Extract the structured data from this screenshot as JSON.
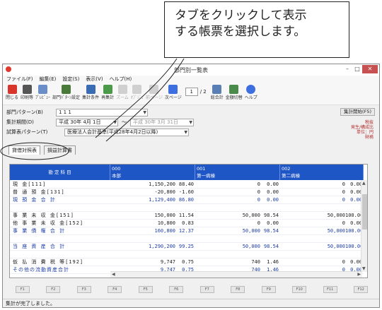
{
  "callout": {
    "line1": "タブをクリックして表示",
    "line2": "する帳票を選択します。"
  },
  "window": {
    "title": "部門別一覧表",
    "minimize": "–",
    "maximize": "□",
    "close": "✕"
  },
  "menu": [
    "ファイル(F)",
    "編集(E)",
    "設定(S)",
    "表示(V)",
    "ヘルプ(H)"
  ],
  "toolbar": {
    "buttons": [
      {
        "label": "閉じる",
        "icon": "close-icon",
        "color": "#d9362b"
      },
      {
        "label": "印刷等",
        "icon": "printer-icon",
        "color": "#555555"
      },
      {
        "label": "ﾌﾟﾚﾋﾞｭｰ",
        "icon": "preview-icon",
        "color": "#6a8fc8"
      },
      {
        "label": "部門ﾊﾟﾀｰﾝ設定",
        "icon": "settings-icon",
        "color": "#4a7a3a"
      },
      {
        "label": "集計条件",
        "icon": "filter-icon",
        "color": "#3a6bb5"
      },
      {
        "label": "再集計",
        "icon": "refresh-icon",
        "color": "#4a9a4a"
      },
      {
        "label": "ズーム",
        "icon": "zoom-icon",
        "color": "#bbbbbb"
      },
      {
        "label": "ｵﾌﾞｼﾞｪ",
        "icon": "object-icon",
        "color": "#bbbbbb"
      },
      {
        "label": "前ページ",
        "icon": "prev-page-icon",
        "color": "#bbbbbb"
      },
      {
        "label": "次ページ",
        "icon": "next-page-icon",
        "color": "#3d6fe0"
      }
    ],
    "page_value": "1",
    "page_total": "/ 2",
    "buttons2": [
      {
        "label": "総合計",
        "icon": "total-icon",
        "color": "#5a7fb5"
      },
      {
        "label": "金額切替",
        "icon": "switch-icon",
        "color": "#4a8a4a"
      },
      {
        "label": "ヘルプ",
        "icon": "help-icon",
        "color": "#3d6fe0"
      }
    ]
  },
  "form": {
    "pattern_label": "部門パターン(B)",
    "pattern_value": "1 1 1",
    "period_label": "集計期間(D)",
    "period_from": "平成 30年  4月  1日",
    "period_sep": "〜",
    "period_to": "平成 30年  3月 31日",
    "trial_label": "試算表パターン(T)",
    "trial_value": "医療法人会計基準(平成28年4月2日以降)",
    "calc_button": "集計開始(F5)",
    "info": [
      "税抜",
      "発生/構成比",
      "単位：円",
      "財務"
    ]
  },
  "tabs": [
    {
      "label": "貸借対照表",
      "active": true
    },
    {
      "label": "損益計算書",
      "active": false
    }
  ],
  "grid": {
    "header_item": "勘 定 科 目",
    "columns": [
      {
        "code": "000",
        "name": "本部"
      },
      {
        "code": "001",
        "name": "第一病棟"
      },
      {
        "code": "002",
        "name": "第二病棟"
      }
    ],
    "rows": [
      {
        "name": "現          金[111]",
        "v": [
          "1,150,200",
          "88.40",
          "0",
          "0.00",
          "0",
          "0.00"
        ],
        "bold": false
      },
      {
        "name": "普  通  預  金[131]",
        "v": [
          "-20,800",
          "-1.60",
          "0",
          "0.00",
          "0",
          "0.00"
        ],
        "bold": false
      },
      {
        "name": "現  預  金  合  計",
        "v": [
          "1,129,400",
          "86.80",
          "0",
          "0.00",
          "0",
          "0.00"
        ],
        "bold": true
      },
      {
        "name": "",
        "v": [
          "",
          "",
          "",
          "",
          "",
          ""
        ],
        "bold": false
      },
      {
        "name": "事 業 未 収 金[151]",
        "v": [
          "150,000",
          "11.54",
          "50,000",
          "98.54",
          "50,000",
          "100.00"
        ],
        "bold": false
      },
      {
        "name": "他 事 業 未 収 金[152]",
        "v": [
          "10,800",
          "0.83",
          "0",
          "0.00",
          "0",
          "0.00"
        ],
        "bold": false
      },
      {
        "name": "事 業 債 権 合 計",
        "v": [
          "160,800",
          "12.37",
          "50,000",
          "98.54",
          "50,000",
          "100.00"
        ],
        "bold": true
      },
      {
        "name": "",
        "v": [
          "",
          "",
          "",
          "",
          "",
          ""
        ],
        "bold": false
      },
      {
        "name": "当 座 資 産 合 計",
        "v": [
          "1,290,200",
          "99.25",
          "50,000",
          "98.54",
          "50,000",
          "100.00"
        ],
        "bold": true
      },
      {
        "name": "",
        "v": [
          "",
          "",
          "",
          "",
          "",
          ""
        ],
        "bold": false
      },
      {
        "name": "仮 払 消 費 税 等[192]",
        "v": [
          "9,747",
          "0.75",
          "740",
          "1.46",
          "0",
          "0.00"
        ],
        "bold": false
      },
      {
        "name": "その他の流動資産合計",
        "v": [
          "9,747",
          "0.75",
          "740",
          "1.46",
          "0",
          "0.00"
        ],
        "bold": true
      }
    ]
  },
  "fkeys": [
    "F1",
    "F2",
    "F3",
    "F4",
    "F5",
    "F6",
    "F7",
    "F8",
    "F9",
    "F10",
    "F11",
    "F12"
  ],
  "status": "集計が完了しました。"
}
